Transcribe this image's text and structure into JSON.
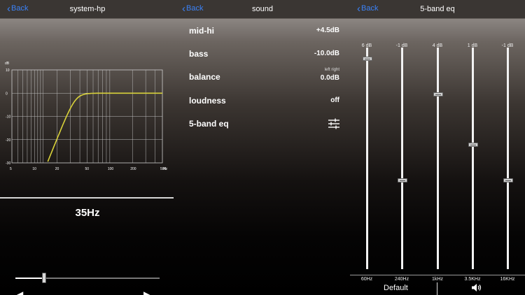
{
  "system_hp": {
    "back_label": "Back",
    "title": "system-hp",
    "graph_unit": "dB",
    "freq_unit": "Hz",
    "y_ticks": [
      "10",
      "0",
      "-10",
      "-20",
      "-30"
    ],
    "x_ticks": [
      "5",
      "10",
      "20",
      "50",
      "100",
      "200",
      "500"
    ],
    "cutoff": "35Hz",
    "slider_value": 0.2
  },
  "sound": {
    "back_label": "Back",
    "title": "sound",
    "rows": [
      {
        "label": "mid-hi",
        "value": "+4.5dB"
      },
      {
        "label": "bass",
        "value": "-10.0dB"
      },
      {
        "label": "balance",
        "value": "0.0dB",
        "sub": "left right"
      },
      {
        "label": "loudness",
        "value": "off"
      },
      {
        "label": "5-band eq",
        "icon": "sliders-icon"
      }
    ]
  },
  "eq": {
    "back_label": "Back",
    "title": "5-band eq",
    "bands": [
      {
        "freq": "60Hz",
        "gain": "6 dB",
        "level": 0.95
      },
      {
        "freq": "240Hz",
        "gain": "-1 dB",
        "level": 0.4
      },
      {
        "freq": "1kHz",
        "gain": "4 dB",
        "level": 0.79
      },
      {
        "freq": "3.5KHz",
        "gain": "1 dB",
        "level": 0.56
      },
      {
        "freq": "16KHz",
        "gain": "-1 dB",
        "level": 0.4
      }
    ],
    "default_label": "Default",
    "speaker_icon": "speaker-icon"
  },
  "colors": {
    "accent": "#3b82f6",
    "curve": "#d9d23a"
  }
}
